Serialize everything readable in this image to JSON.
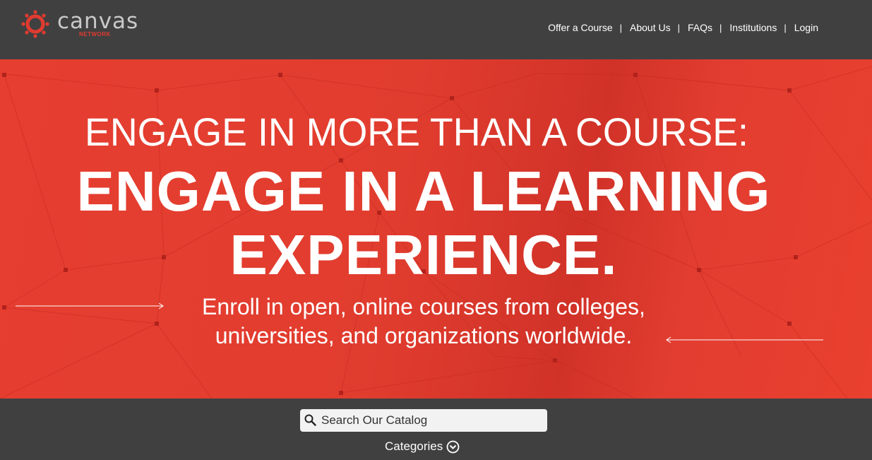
{
  "logo": {
    "name": "canvas",
    "sub": "NETWORK",
    "icon": "canvas-logo-icon",
    "accent_color": "#e23b2f"
  },
  "nav": {
    "items": [
      {
        "label": "Offer a Course"
      },
      {
        "label": "About Us"
      },
      {
        "label": "FAQs"
      },
      {
        "label": "Institutions"
      },
      {
        "label": "Login"
      }
    ],
    "separator": "|"
  },
  "hero": {
    "line1": "ENGAGE IN MORE THAN A COURSE:",
    "line2": "ENGAGE IN A LEARNING",
    "line3": "EXPERIENCE.",
    "tagline_1": "Enroll in open, online courses from colleges,",
    "tagline_2": "universities, and organizations worldwide.",
    "background_color": "#e23d30"
  },
  "search": {
    "placeholder": "Search Our Catalog",
    "icon": "search-icon"
  },
  "categories": {
    "label": "Categories",
    "icon": "chevron-down-circle-icon"
  },
  "colors": {
    "header_bg": "#404041",
    "text": "#ffffff"
  }
}
